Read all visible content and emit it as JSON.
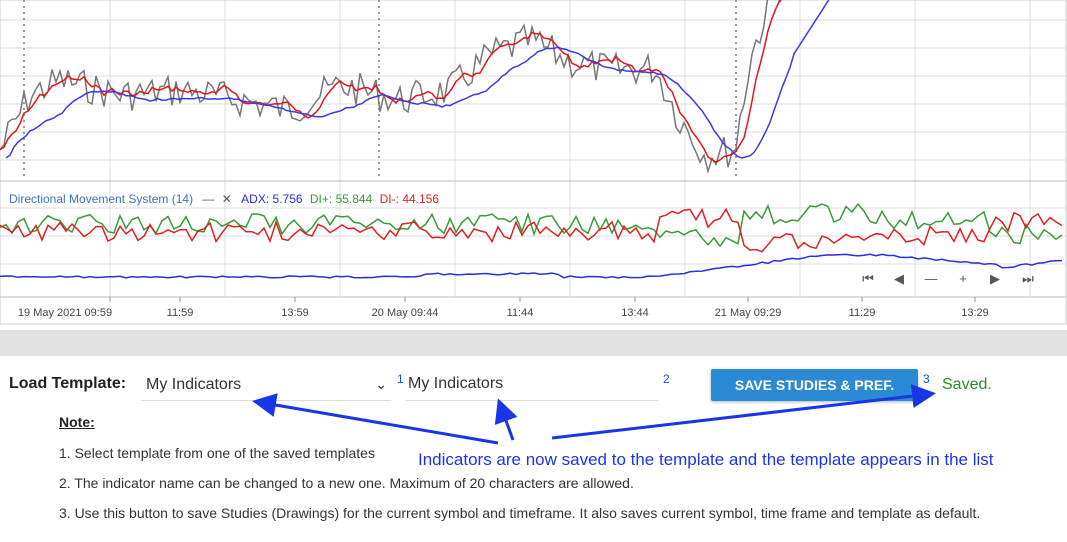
{
  "chart": {
    "indicator_name": "Directional Movement System (14)",
    "indicator_minus": "—",
    "indicator_close": "✕",
    "adx_label": "ADX:",
    "adx_value": "5.756",
    "diplus_label": "DI+:",
    "diplus_value": "55.844",
    "diminus_label": "DI-:",
    "diminus_value": "44.156",
    "x_ticks": [
      "19 May 2021 09:59",
      "11:59",
      "13:59",
      "20 May 09:44",
      "11:44",
      "13:44",
      "21 May 09:29",
      "11:29",
      "13:29"
    ],
    "nav_icons": [
      "first-icon",
      "prev-icon",
      "zoom-out-icon",
      "zoom-in-icon",
      "next-icon",
      "last-icon"
    ],
    "nav_glyphs": [
      "⏮",
      "◀",
      "—",
      "+",
      "▶",
      "⏭"
    ],
    "colors": {
      "price": "#777777",
      "fast_ma": "#e8131b",
      "slow_ma": "#3a3ae8",
      "adx": "#2d2de0",
      "di_plus": "#3a9a3a",
      "di_minus": "#e02020",
      "grid": "#dcdcdc"
    }
  },
  "form": {
    "load_template_label": "Load Template:",
    "template_selected": "My Indicators",
    "step1": "1",
    "step2": "2",
    "step3": "3",
    "indicator_name_value": "My Indicators",
    "save_button_label": "SAVE STUDIES & PREF.",
    "saved_status": "Saved."
  },
  "notes": {
    "title": "Note:",
    "items": [
      "1. Select template from one of the saved templates",
      "2. The indicator name can be changed to a new one. Maximum of 20 characters are allowed.",
      "3. Use this button to save Studies (Drawings) for the current symbol and timeframe. It also saves current symbol, time frame and template as default."
    ]
  },
  "annotation": {
    "text": "Indicators are now saved to the template and the template appears in the list",
    "color": "#1a35e8"
  }
}
